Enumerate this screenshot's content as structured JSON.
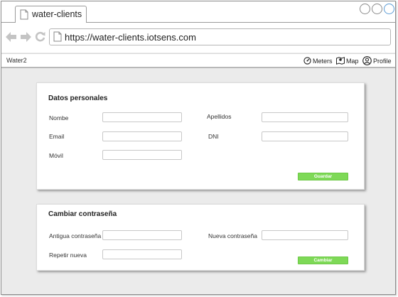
{
  "browser": {
    "tab_title": "water-clients",
    "url": "https://water-clients.iotsens.com"
  },
  "app": {
    "brand": "Water2",
    "nav": [
      {
        "label": "Meters",
        "icon": "gauge-icon"
      },
      {
        "label": "Map",
        "icon": "map-icon"
      },
      {
        "label": "Profile",
        "icon": "user-icon"
      }
    ]
  },
  "personal": {
    "title": "Datos personales",
    "name_label": "Nombe",
    "surname_label": "Apellidos",
    "email_label": "Email",
    "dni_label": "DNI",
    "mobile_label": "Móvil",
    "save_button": "Guardar"
  },
  "password": {
    "title": "Cambiar contraseña",
    "old_label": "Antigua contraseña",
    "new_label": "Nueva contraseña",
    "repeat_label": "Repetir nueva",
    "change_button": "Cambiar"
  },
  "colors": {
    "accent_green": "#7ed957",
    "background": "#ebebeb",
    "close_button_border": "#5b9bd5"
  }
}
